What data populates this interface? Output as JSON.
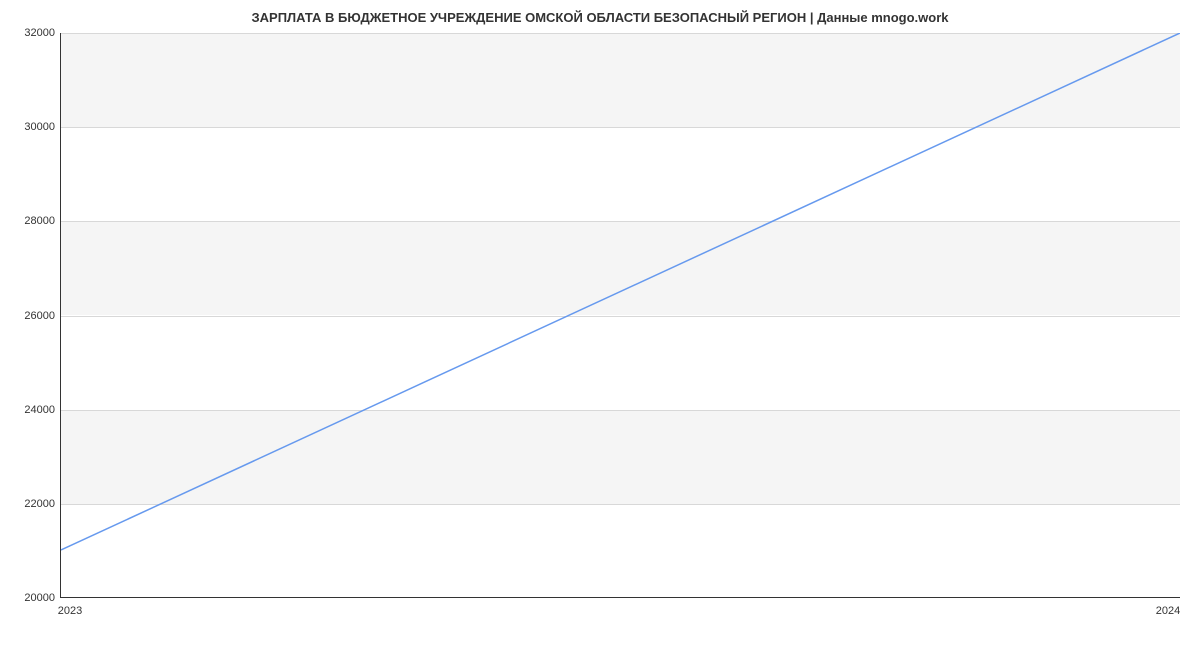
{
  "chart_data": {
    "type": "line",
    "title": "ЗАРПЛАТА В БЮДЖЕТНОЕ УЧРЕЖДЕНИЕ ОМСКОЙ ОБЛАСТИ БЕЗОПАСНЫЙ РЕГИОН | Данные mnogo.work",
    "x": [
      "2023",
      "2024"
    ],
    "values": [
      21000,
      32000
    ],
    "xlabel": "",
    "ylabel": "",
    "ylim": [
      20000,
      32000
    ],
    "x_tick_labels": [
      "2023",
      "2024"
    ],
    "y_tick_labels": [
      "20000",
      "22000",
      "24000",
      "26000",
      "28000",
      "30000",
      "32000"
    ],
    "line_color": "#6699ee"
  }
}
